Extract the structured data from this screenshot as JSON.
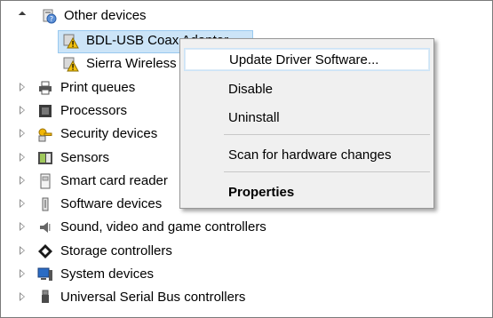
{
  "tree": {
    "other_devices": {
      "label": "Other devices",
      "icon": "unknown-device-icon"
    },
    "children": [
      {
        "label": "BDL-USB Coax Adaptor",
        "icon": "warning-device-icon",
        "selected": true
      },
      {
        "label": "Sierra Wireless",
        "icon": "warning-device-icon"
      }
    ],
    "categories": [
      {
        "label": "Print queues",
        "icon": "printer-icon"
      },
      {
        "label": "Processors",
        "icon": "processor-icon"
      },
      {
        "label": "Security devices",
        "icon": "key-icon"
      },
      {
        "label": "Sensors",
        "icon": "sensor-icon"
      },
      {
        "label": "Smart card reader",
        "icon": "smart-card-icon"
      },
      {
        "label": "Software devices",
        "icon": "software-device-icon"
      },
      {
        "label": "Sound, video and game controllers",
        "icon": "speaker-icon"
      },
      {
        "label": "Storage controllers",
        "icon": "storage-icon"
      },
      {
        "label": "System devices",
        "icon": "monitor-icon"
      },
      {
        "label": "Universal Serial Bus controllers",
        "icon": "usb-icon"
      }
    ]
  },
  "context_menu": {
    "items": [
      {
        "label": "Update Driver Software...",
        "highlighted": true
      },
      {
        "label": "Disable"
      },
      {
        "label": "Uninstall"
      },
      {
        "label": "Scan for hardware changes"
      },
      {
        "label": "Properties",
        "bold": true
      }
    ]
  },
  "colors": {
    "selection": "#cce4f7",
    "menu_bg": "#f0f0f0",
    "warning": "#f4c20d"
  }
}
